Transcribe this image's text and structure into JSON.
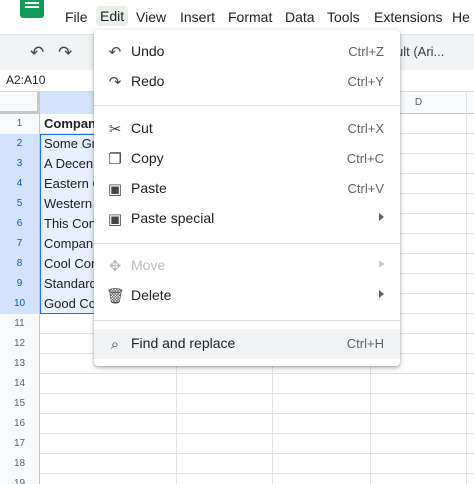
{
  "menubar": {
    "items": [
      "File",
      "Edit",
      "View",
      "Insert",
      "Format",
      "Data",
      "Tools",
      "Extensions",
      "He"
    ]
  },
  "toolbar": {
    "font": "ult (Ari..."
  },
  "namebox": "A2:A10",
  "column_header": "D",
  "rows": [
    {
      "num": "1",
      "a": "Compan"
    },
    {
      "num": "2",
      "a": "Some Gr"
    },
    {
      "num": "3",
      "a": "A Decen"
    },
    {
      "num": "4",
      "a": "Eastern C"
    },
    {
      "num": "5",
      "a": "Western"
    },
    {
      "num": "6",
      "a": "This Con"
    },
    {
      "num": "7",
      "a": "Compan"
    },
    {
      "num": "8",
      "a": "Cool Cor"
    },
    {
      "num": "9",
      "a": "Standard"
    },
    {
      "num": "10",
      "a": "Good Co"
    },
    {
      "num": "11",
      "a": ""
    },
    {
      "num": "12",
      "a": ""
    },
    {
      "num": "13",
      "a": ""
    },
    {
      "num": "14",
      "a": ""
    },
    {
      "num": "15",
      "a": ""
    },
    {
      "num": "16",
      "a": ""
    },
    {
      "num": "17",
      "a": ""
    },
    {
      "num": "18",
      "a": ""
    },
    {
      "num": "19",
      "a": ""
    }
  ],
  "edit_menu": {
    "undo": {
      "label": "Undo",
      "shortcut": "Ctrl+Z"
    },
    "redo": {
      "label": "Redo",
      "shortcut": "Ctrl+Y"
    },
    "cut": {
      "label": "Cut",
      "shortcut": "Ctrl+X"
    },
    "copy": {
      "label": "Copy",
      "shortcut": "Ctrl+C"
    },
    "paste": {
      "label": "Paste",
      "shortcut": "Ctrl+V"
    },
    "paste_special": {
      "label": "Paste special"
    },
    "move": {
      "label": "Move"
    },
    "delete": {
      "label": "Delete"
    },
    "find_replace": {
      "label": "Find and replace",
      "shortcut": "Ctrl+H"
    }
  },
  "colors": {
    "accent": "#1a73e8",
    "logo": "#0f9d58",
    "selection": "#e8f0fe"
  },
  "icons": [
    "sheets-logo-icon",
    "undo-icon",
    "redo-icon",
    "cut-icon",
    "copy-icon",
    "paste-icon",
    "move-icon",
    "delete-icon",
    "find-replace-icon"
  ]
}
